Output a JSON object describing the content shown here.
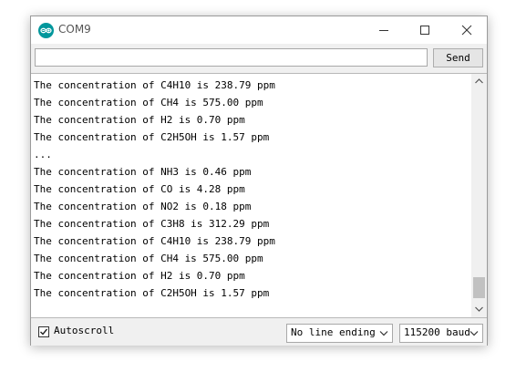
{
  "window": {
    "title": "COM9",
    "accent_color": "#00979c"
  },
  "toolbar": {
    "input_value": "",
    "send_label": "Send"
  },
  "output": {
    "lines": [
      "The concentration of C4H10 is 238.79 ppm",
      "The concentration of CH4 is 575.00 ppm",
      "The concentration of H2 is 0.70 ppm",
      "The concentration of C2H5OH is 1.57 ppm",
      "...",
      "The concentration of NH3 is 0.46 ppm",
      "The concentration of CO is 4.28 ppm",
      "The concentration of NO2 is 0.18 ppm",
      "The concentration of C3H8 is 312.29 ppm",
      "The concentration of C4H10 is 238.79 ppm",
      "The concentration of CH4 is 575.00 ppm",
      "The concentration of H2 is 0.70 ppm",
      "The concentration of C2H5OH is 1.57 ppm"
    ],
    "scroll_position": 0.98,
    "scroll_visible_fraction": 0.1
  },
  "status": {
    "autoscroll_label": "Autoscroll",
    "autoscroll_checked": true,
    "line_ending_value": "No line ending",
    "baud_value": "115200 baud"
  }
}
